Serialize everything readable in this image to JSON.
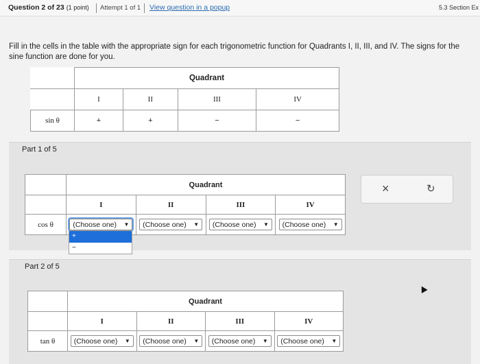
{
  "topbar": {
    "question": "Question 2 of 23",
    "points": "(1 point)",
    "attempt": "Attempt 1 of 1",
    "popup_link": "View question in a popup",
    "section": "5.3 Section Ex"
  },
  "instructions": "Fill in the cells in the table with the appropriate sign for each trigonometric function for Quadrants I, II, III, and IV. The signs for the sine function are done for you.",
  "example_table": {
    "header": "Quadrant",
    "quadrants": [
      "I",
      "II",
      "III",
      "IV"
    ],
    "function": "sin θ",
    "signs": [
      "+",
      "+",
      "−",
      "−"
    ]
  },
  "part1": {
    "label": "Part 1 of 5",
    "header": "Quadrant",
    "quadrants": [
      "I",
      "II",
      "III",
      "IV"
    ],
    "function": "cos θ",
    "selects": [
      "(Choose one)",
      "(Choose one)",
      "(Choose one)",
      "(Choose one)"
    ],
    "dropdown_options": [
      "+",
      "−"
    ]
  },
  "part2": {
    "label": "Part 2 of 5",
    "header": "Quadrant",
    "quadrants": [
      "I",
      "II",
      "III",
      "IV"
    ],
    "function": "tan θ",
    "selects": [
      "(Choose one)",
      "(Choose one)",
      "(Choose one)",
      "(Choose one)"
    ]
  },
  "tools": {
    "clear_icon": "×",
    "undo_icon": "↻"
  }
}
